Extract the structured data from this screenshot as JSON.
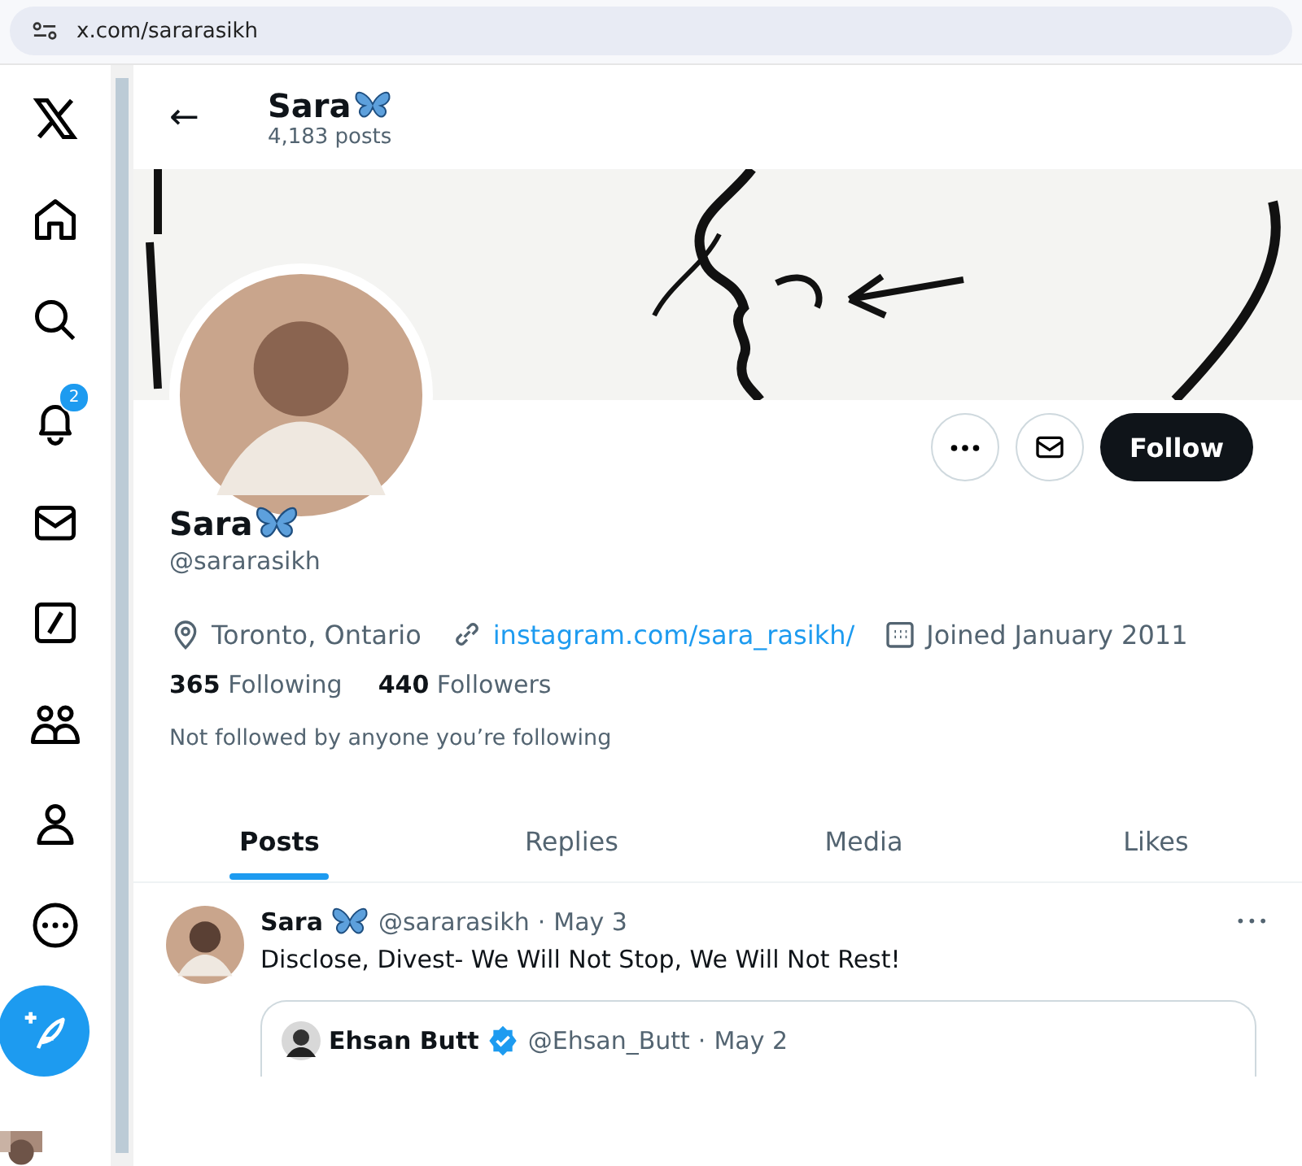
{
  "browser": {
    "url": "x.com/sararasikh"
  },
  "nav": {
    "items": [
      {
        "kind": "logo"
      },
      {
        "kind": "home"
      },
      {
        "kind": "search"
      },
      {
        "kind": "bell",
        "badge": "2"
      },
      {
        "kind": "mail"
      },
      {
        "kind": "slash"
      },
      {
        "kind": "people"
      },
      {
        "kind": "person"
      },
      {
        "kind": "more"
      },
      {
        "kind": "post"
      }
    ]
  },
  "header": {
    "back": "←",
    "name": "Sara",
    "posts": "4,183 posts"
  },
  "profile": {
    "name": "Sara",
    "handle": "@sararasikh",
    "follow": "Follow",
    "location": "Toronto, Ontario",
    "website": "instagram.com/sara_rasikh/",
    "joined": "Joined January 2011",
    "following_count": "365",
    "following_label": "Following",
    "followers_count": "440",
    "followers_label": "Followers",
    "note": "Not followed by anyone you’re following"
  },
  "tabs": [
    {
      "label": "Posts",
      "selected": true
    },
    {
      "label": "Replies",
      "selected": false
    },
    {
      "label": "Media",
      "selected": false
    },
    {
      "label": "Likes",
      "selected": false
    }
  ],
  "post": {
    "name": "Sara",
    "handle": "@sararasikh",
    "sep": "·",
    "date": "May 3",
    "more": "•••",
    "text": "Disclose, Divest- We Will Not Stop, We Will Not Rest!",
    "quote": {
      "name": "Ehsan Butt",
      "verified": true,
      "handle": "@Ehsan_Butt",
      "sep": "·",
      "date": "May 2"
    }
  }
}
